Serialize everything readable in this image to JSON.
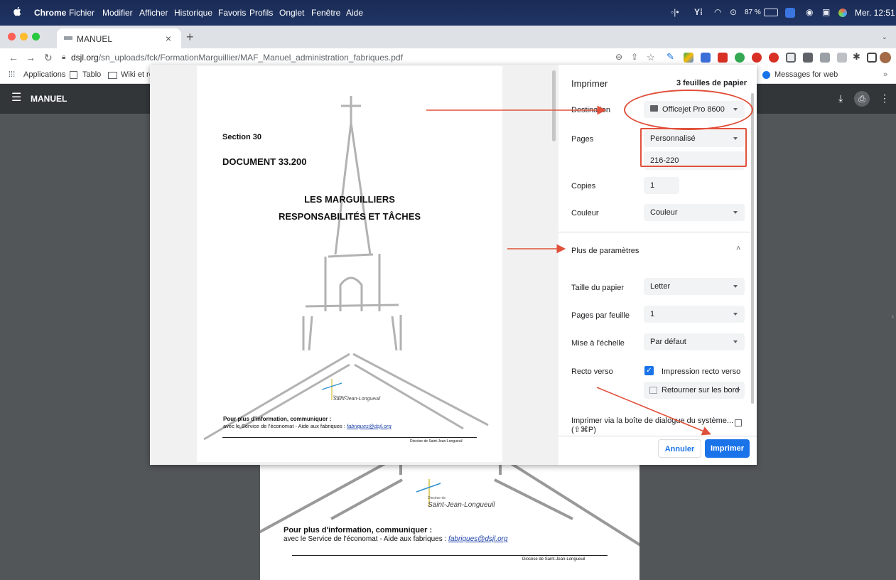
{
  "menubar": {
    "items": [
      "Chrome",
      "Fichier",
      "Modifier",
      "Afficher",
      "Historique",
      "Favoris",
      "Profils",
      "Onglet",
      "Fenêtre",
      "Aide"
    ],
    "battery": "87 %",
    "clock": "Mer. 12:51"
  },
  "tab": {
    "title": "MANUEL",
    "close": "×",
    "new": "+"
  },
  "address": {
    "domain": "dsjl.org",
    "path": "/sn_uploads/fck/FormationMarguillier/MAF_Manuel_administration_fabriques.pdf"
  },
  "bookmarks": [
    "Applications",
    "Tablo",
    "Wiki et réf",
    "Messages for web"
  ],
  "pdf_viewer": {
    "title": "MANUEL"
  },
  "document": {
    "section": "Section 30",
    "doc_number": "DOCUMENT 33.200",
    "title_line1": "LES MARGUILLIERS",
    "title_line2": "RESPONSABILITÉS ET TÂCHES",
    "logo_small": "Diocèse de",
    "logo_text": "Saint-Jean-Longueuil",
    "info_heading": "Pour plus d'information, communiquer :",
    "info_text": "avec le Service de l'économat - Aide aux fabriques : ",
    "email": "fabriques@dsjl.org",
    "footer": "Diocèse de Saint-Jean-Longueuil"
  },
  "print": {
    "title": "Imprimer",
    "sheets": "3 feuilles de papier",
    "destination_label": "Destination",
    "destination_value": "Officejet Pro 8600",
    "pages_label": "Pages",
    "pages_value": "Personnalisé",
    "pages_range": "216-220",
    "copies_label": "Copies",
    "copies_value": "1",
    "color_label": "Couleur",
    "color_value": "Couleur",
    "more_settings": "Plus de paramètres",
    "paper_size_label": "Taille du papier",
    "paper_size_value": "Letter",
    "pages_per_sheet_label": "Pages par feuille",
    "pages_per_sheet_value": "1",
    "scale_label": "Mise à l'échelle",
    "scale_value": "Par défaut",
    "duplex_label": "Recto verso",
    "duplex_option": "Impression recto verso",
    "duplex_checked": true,
    "flip_option": "Retourner sur les bord",
    "system_dialog_line1": "Imprimer via la boîte de dialogue du système...",
    "system_dialog_line2": "(⇧⌘P)",
    "cancel": "Annuler",
    "print": "Imprimer"
  },
  "colors": {
    "accent": "#1a73e8",
    "annotation": "#e0503a",
    "viewer_bg": "#525659",
    "toolbar": "#323639"
  }
}
